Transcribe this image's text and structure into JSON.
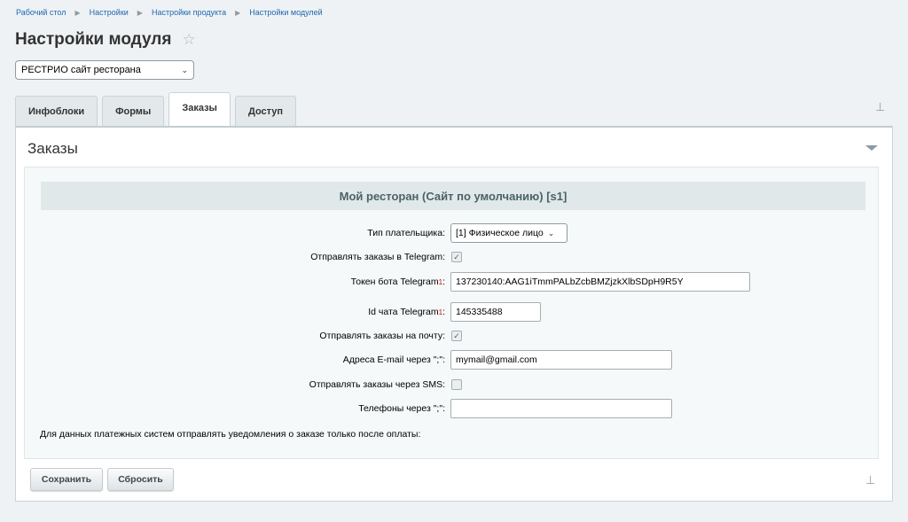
{
  "breadcrumb": [
    "Рабочий стол",
    "Настройки",
    "Настройки продукта",
    "Настройки модулей"
  ],
  "page_title": "Настройки модуля",
  "site_select": {
    "value": "РЕСТРИО сайт ресторана"
  },
  "tabs": [
    {
      "label": "Инфоблоки"
    },
    {
      "label": "Формы"
    },
    {
      "label": "Заказы",
      "active": true
    },
    {
      "label": "Доступ"
    }
  ],
  "panel": {
    "title": "Заказы",
    "section_header": "Мой ресторан (Сайт по умолчанию) [s1]"
  },
  "form": {
    "payer_type": {
      "label": "Тип плательщика:",
      "value": "[1] Физическое лицо"
    },
    "send_telegram": {
      "label": "Отправлять заказы в Telegram:",
      "checked": true
    },
    "bot_token": {
      "label": "Токен бота Telegram",
      "value": "137230140:AAG1iTmmPALbZcbBMZjzkXlbSDpH9R5Y"
    },
    "chat_id": {
      "label": "Id чата Telegram",
      "value": "145335488"
    },
    "send_email": {
      "label": "Отправлять заказы на почту:",
      "checked": true
    },
    "email": {
      "label": "Адреса E-mail через \";\":",
      "value": "mymail@gmail.com"
    },
    "send_sms": {
      "label": "Отправлять заказы через SMS:",
      "checked": false
    },
    "phones": {
      "label": "Телефоны через \";\":",
      "value": ""
    },
    "notify_after_payment": {
      "label": "Для данных платежных систем отправлять уведомления о заказе только после оплаты:"
    },
    "required_mark": "1",
    "colon": ":"
  },
  "buttons": {
    "save": "Сохранить",
    "reset": "Сбросить"
  },
  "icons": {
    "star": "star-icon",
    "pin": "pin-icon",
    "collapse": "collapse-icon",
    "check": "check-icon"
  }
}
